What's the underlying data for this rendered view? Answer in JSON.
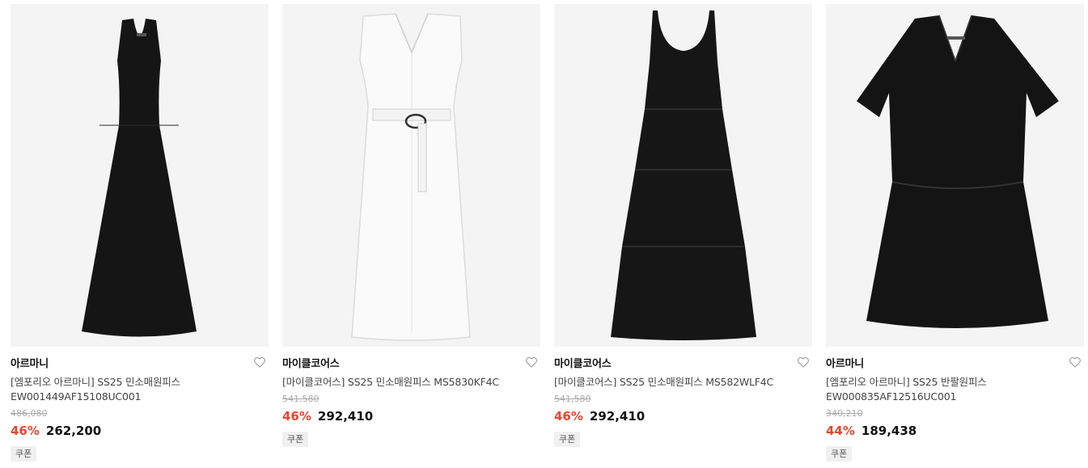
{
  "products": [
    {
      "brand": "아르마니",
      "name": "[엠포리오 아르마니] SS25 민소매원피스 EW001449AF15108UC001",
      "original_price": "486,080",
      "discount": "46%",
      "price": "262,200",
      "badge": "쿠폰",
      "image_icon": "black-sleeveless-dress",
      "image_color": "#151515"
    },
    {
      "brand": "마이클코어스",
      "name": "[마이클코어스] SS25 민소매원피스 MS5830KF4C",
      "original_price": "541,580",
      "discount": "46%",
      "price": "292,410",
      "badge": "쿠폰",
      "image_icon": "white-belted-dress",
      "image_color": "#f7f7f7"
    },
    {
      "brand": "마이클코어스",
      "name": "[마이클코어스] SS25 민소매원피스 MS582WLF4C",
      "original_price": "541,580",
      "discount": "46%",
      "price": "292,410",
      "badge": "쿠폰",
      "image_icon": "black-tiered-maxi-dress",
      "image_color": "#161616"
    },
    {
      "brand": "아르마니",
      "name": "[엠포리오 아르마니] SS25 반팔원피스 EW000835AF12516UC001",
      "original_price": "340,210",
      "discount": "44%",
      "price": "189,438",
      "badge": "쿠폰",
      "image_icon": "black-short-sleeve-dress",
      "image_color": "#141414"
    }
  ],
  "wishlist_icon": "heart-outline-icon"
}
